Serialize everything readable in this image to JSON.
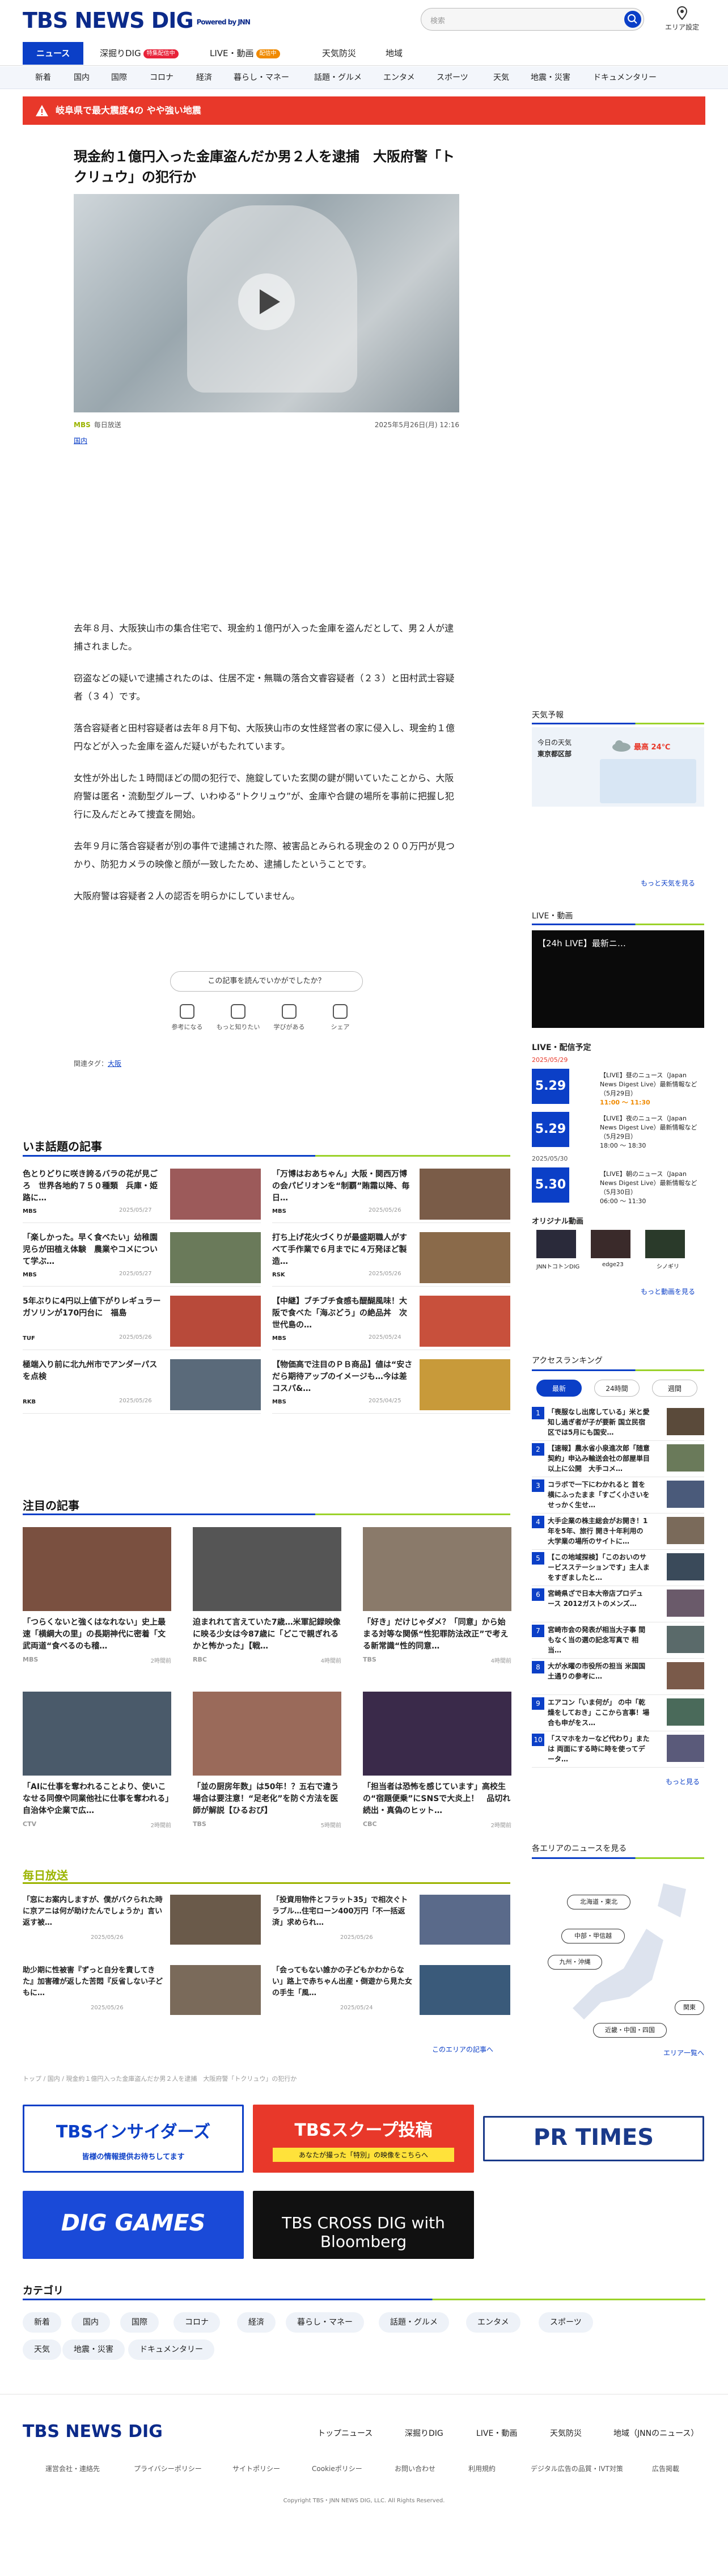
{
  "header": {
    "logo": "TBS NEWS DIG",
    "powered": "Powered by JNN",
    "search_placeholder": "検索",
    "area_label": "エリア設定"
  },
  "nav1": [
    {
      "label": "ニュース"
    },
    {
      "label": "深掘りDIG",
      "badge": "特集配信中"
    },
    {
      "label": "LIVE・動画",
      "badge": "配信中"
    },
    {
      "label": "天気防災"
    },
    {
      "label": "地域"
    }
  ],
  "nav2": [
    "新着",
    "国内",
    "国際",
    "コロナ",
    "経済",
    "暮らし・マネー",
    "話題・グルメ",
    "エンタメ",
    "スポーツ",
    "天気",
    "地震・災害",
    "ドキュメンタリー"
  ],
  "alert": "岐阜県で最大震度4の やや強い地震",
  "article": {
    "title": "現金約１億円入った金庫盗んだか男２人を逮捕　大阪府警「トクリュウ」の犯行か",
    "source": "MBS",
    "source_name": "毎日放送",
    "date": "2025年5月26日(月) 12:16",
    "category": "国内",
    "paragraphs": [
      "去年８月、大阪狭山市の集合住宅で、現金約１億円が入った金庫を盗んだとして、男２人が逮捕されました。",
      "窃盗などの疑いで逮捕されたのは、住居不定・無職の落合文睿容疑者（２３）と田村武士容疑者（３４）です。",
      "落合容疑者と田村容疑者は去年８月下旬、大阪狭山市の女性経営者の家に侵入し、現金約１億円などが入った金庫を盗んだ疑いがもたれています。",
      "女性が外出した１時間ほどの間の犯行で、施錠していた玄関の鍵が開いていたことから、大阪府警は匿名・流動型グループ、いわゆる“トクリュウ”が、金庫や合鍵の場所を事前に把握し犯行に及んだとみて捜査を開始。",
      "去年９月に落合容疑者が別の事件で逮捕された際、被害品とみられる現金の２００万円が見つかり、防犯カメラの映像と顔が一致したため、逮捕したということです。",
      "大阪府警は容疑者２人の認否を明らかにしていません。"
    ],
    "feedback_q": "この記事を読んでいかがでしたか？",
    "feedback": [
      "参考になる",
      "もっと知りたい",
      "学びがある",
      "シェア"
    ],
    "tags_label": "関連タグ：",
    "tags": [
      "大阪"
    ]
  },
  "hot": {
    "title": "いま話題の記事",
    "items": [
      {
        "t": "色とりどりに咲き誇るバラの花が見ごろ　世界各地約７５０種類　兵庫・姫路に…",
        "src": "MBS",
        "date": "2025/05/27",
        "c": "#9c5a5a"
      },
      {
        "t": "「万博はおあちゃん」大阪・関西万博の会パビリオンを“制覇”賄霜以降、毎日…",
        "src": "MBS",
        "date": "2025/05/26",
        "c": "#7a5c48"
      },
      {
        "t": "「楽しかった。早く食べたい」幼稚園児らが田植え体験　農業やコメについて学ぶ…",
        "src": "MBS",
        "date": "2025/05/27",
        "c": "#6a7a5a"
      },
      {
        "t": "打ち上げ花火づくりが最盛期職人がすべて手作業で６月までに４万発ほど製造…",
        "src": "RSK",
        "date": "2025/05/26",
        "c": "#8a6a4a"
      },
      {
        "t": "5年ぶりに4円以上値下がりレギュラーガソリンが170円台に　福島",
        "src": "TUF",
        "date": "2025/05/26",
        "c": "#b84a3a"
      },
      {
        "t": "【中継】ブチブチ食感も醍醐風味！大阪で食べた「海ぶどう」の絶品丼　次世代島の…",
        "src": "MBS",
        "date": "2025/05/24",
        "c": "#c8503c"
      },
      {
        "t": "極端入り前に北九州市でアンダーパスを点検",
        "src": "RKB",
        "date": "2025/05/26",
        "c": "#5a6a7a"
      },
      {
        "t": "【物価高で注目のＰＢ商品】値は“安さだら期待アップのイメージも…今は差コスパ&…",
        "src": "MBS",
        "date": "2025/04/25",
        "c": "#c89a3a"
      }
    ]
  },
  "featured": {
    "title": "注目の記事",
    "items": [
      {
        "t": "「つらくないと強くはなれない」史上最速「横綱大の里」の長期神代に密着「文武両道“食べるのも稽…",
        "src": "MBS",
        "date": "2時間前",
        "c": "#7a5040"
      },
      {
        "t": "迫まれれて言えていた7歳…米軍記録映像に映る少女は今87歳に「どこで親ぎれるかと怖かった」【戦…",
        "src": "RBC",
        "date": "4時間前",
        "c": "#555555"
      },
      {
        "t": "「好き」だけじゃダメ？「同意」から始まる対等な関係“性犯罪防法改正”で考える新常識“性的同意…",
        "src": "TBS",
        "date": "4時間前",
        "c": "#8a7a6a"
      },
      {
        "t": "「AIに仕事を奪われることより、使いこなせる同僚や同業他社に仕事を奪われる」自治体や企業で広…",
        "src": "CTV",
        "date": "2時間前",
        "c": "#4a5a6a"
      },
      {
        "t": "「並の厨房年数」は50年！？五右で違う場合は要注意！“足老化”を防ぐ方法を医師が解説【ひるおび】",
        "src": "TBS",
        "date": "5時間前",
        "c": "#9a6a5a"
      },
      {
        "t": "「担当者は恐怖を感じています」高校生の“宿題便乗”にSNSで大炎上！　品切れ続出・真偽のヒット…",
        "src": "CBC",
        "date": "2時間前",
        "c": "#3a2a4a"
      }
    ]
  },
  "mbs": {
    "title": "毎日放送",
    "items": [
      {
        "t": "「窓にお案内しますが、僕がバクられた時に京アニは何が助けたんでしょうか」言い返す被…",
        "date": "2025/05/26",
        "c": "#6a5a4a"
      },
      {
        "t": "「投資用物件とフラット35」で相次ぐトラブル…住宅ローン400万円「不一括返済」求められ…",
        "date": "2025/05/26",
        "c": "#5a6a8a"
      },
      {
        "t": "助少期に性被害『ずっと自分を責してきた』加害確が返した苦悶『反省しない子どもに…",
        "date": "2025/05/26",
        "c": "#7a6a5a"
      },
      {
        "t": "「会ってもない誰かの子どもかわからない」路上で赤ちゃん出産・倒遊から見た女の手生「風…",
        "date": "2025/05/24",
        "c": "#3a5a7a"
      }
    ],
    "more": "このエリアの記事へ"
  },
  "breadcrumb": "トップ / 国内 / 現金約１億円入った金庫盗んだか男２人を逮捕　大阪府警「トクリュウ」の犯行か",
  "banners": [
    {
      "label": "TBSインサイダーズ",
      "sub": "皆様の情報提供お待ちしてます",
      "bg": "#ffffff",
      "fg": "#0b3fc7"
    },
    {
      "label": "TBSスクープ投稿",
      "sub": "あなたが撮った「特別」の映像をこちらへ",
      "bg": "#e8382a",
      "fg": "#ffffff"
    },
    {
      "label": "PR TIMES",
      "sub": "",
      "bg": "#ffffff",
      "fg": "#1a3a8a"
    },
    {
      "label": "DIG GAMES",
      "sub": "",
      "bg": "#1a4ad8",
      "fg": "#ffffff"
    },
    {
      "label": "TBS CROSS DIG with Bloomberg",
      "sub": "",
      "bg": "#111111",
      "fg": "#ffffff"
    }
  ],
  "categories": {
    "title": "カテゴリ",
    "items": [
      "新着",
      "国内",
      "国際",
      "コロナ",
      "経済",
      "暮らし・マネー",
      "話題・グルメ",
      "エンタメ",
      "スポーツ",
      "天気",
      "地震・災害",
      "ドキュメンタリー"
    ]
  },
  "footer": {
    "logo": "TBS NEWS DIG",
    "nav": [
      "トップニュース",
      "深掘りDIG",
      "LIVE・動画",
      "天気防災",
      "地域（JNNのニュース）"
    ],
    "sub": [
      "運営会社・連絡先",
      "プライバシーポリシー",
      "サイトポリシー",
      "Cookieポリシー",
      "お問い合わせ",
      "利用規約",
      "デジタル広告の品質・IVT対策",
      "広告掲載"
    ],
    "copy": "Copyright TBS・JNN NEWS DIG, LLC. All Rights Reserved."
  },
  "sidebar": {
    "weather": {
      "title": "天気予報",
      "today": "今日の天気",
      "region": "東京都区部",
      "temp_high": "最高 24℃",
      "more": "もっと天気を見る"
    },
    "live": {
      "title": "LIVE・動画",
      "video_title": "【24h LIVE】最新ニ…",
      "schedule_title": "LIVE・配信予定",
      "tabs_date1": "2025/05/29",
      "tabs_date2": "2025/05/30",
      "items": [
        {
          "d": "5.29",
          "t": "【LIVE】昼のニュース（Japan News Digest Live）最新情報など（5月29日）",
          "time": "11:00 ～ 11:30"
        },
        {
          "d": "5.29",
          "t": "【LIVE】夜のニュース（Japan News Digest Live）最新情報など（5月29日）",
          "time": "18:00 ～ 18:30"
        },
        {
          "d": "5.30",
          "t": "【LIVE】朝のニュース（Japan News Digest Live）最新情報など（5月30日）",
          "time": "06:00 ～ 11:30"
        }
      ],
      "original": "オリジナル動画",
      "orig": [
        "JNNトコトンDIG",
        "edge23",
        "シノギリ"
      ],
      "more": "もっと動画を見る"
    },
    "rank": {
      "title": "アクセスランキング",
      "tabs": [
        "最新",
        "24時間",
        "週間"
      ],
      "items": [
        "「喪服なし出席している」米と愛知し過ぎ者が子が要新 国立民宿区では5月にも国安…",
        "【速報】農水省小泉進次郎「随意契約」申込み輸送会社の部屋単目以上に公開　大手コメ…",
        "コラボで一下にわかれると 首を横にふったまま「すごく小さいをせっかく生せ…",
        "大手企業の株主総会がお開き！1年を5年、旅行 開き十年利用の大学業の場所のサイトに…",
        "【この地域探検】「このおいのサービスステーションです」主人まをすぎましたと…",
        "宮崎県ざで日本大帝店プロデュース 2012ガストのメンズ…",
        "宮崎市会の発表が相当大子事 間もなく当の選の記念写真で 相当…",
        "大が水曜の市役所の担当 米国国土通りの参考に…",
        "エアコン「いま何が」 の中「乾燥をしておき」ここから言事！場合も申がをス…",
        "「スマホをカーなど代わり」または 両面にする時に時を使ってデータ…"
      ],
      "more": "もっと見る"
    },
    "areas": {
      "title": "各エリアのニュースを見る",
      "items": [
        "北海道・東北",
        "中部・甲信越",
        "九州・沖縄",
        "関東",
        "近畿・中国・四国"
      ],
      "more": "エリア一覧へ"
    }
  }
}
